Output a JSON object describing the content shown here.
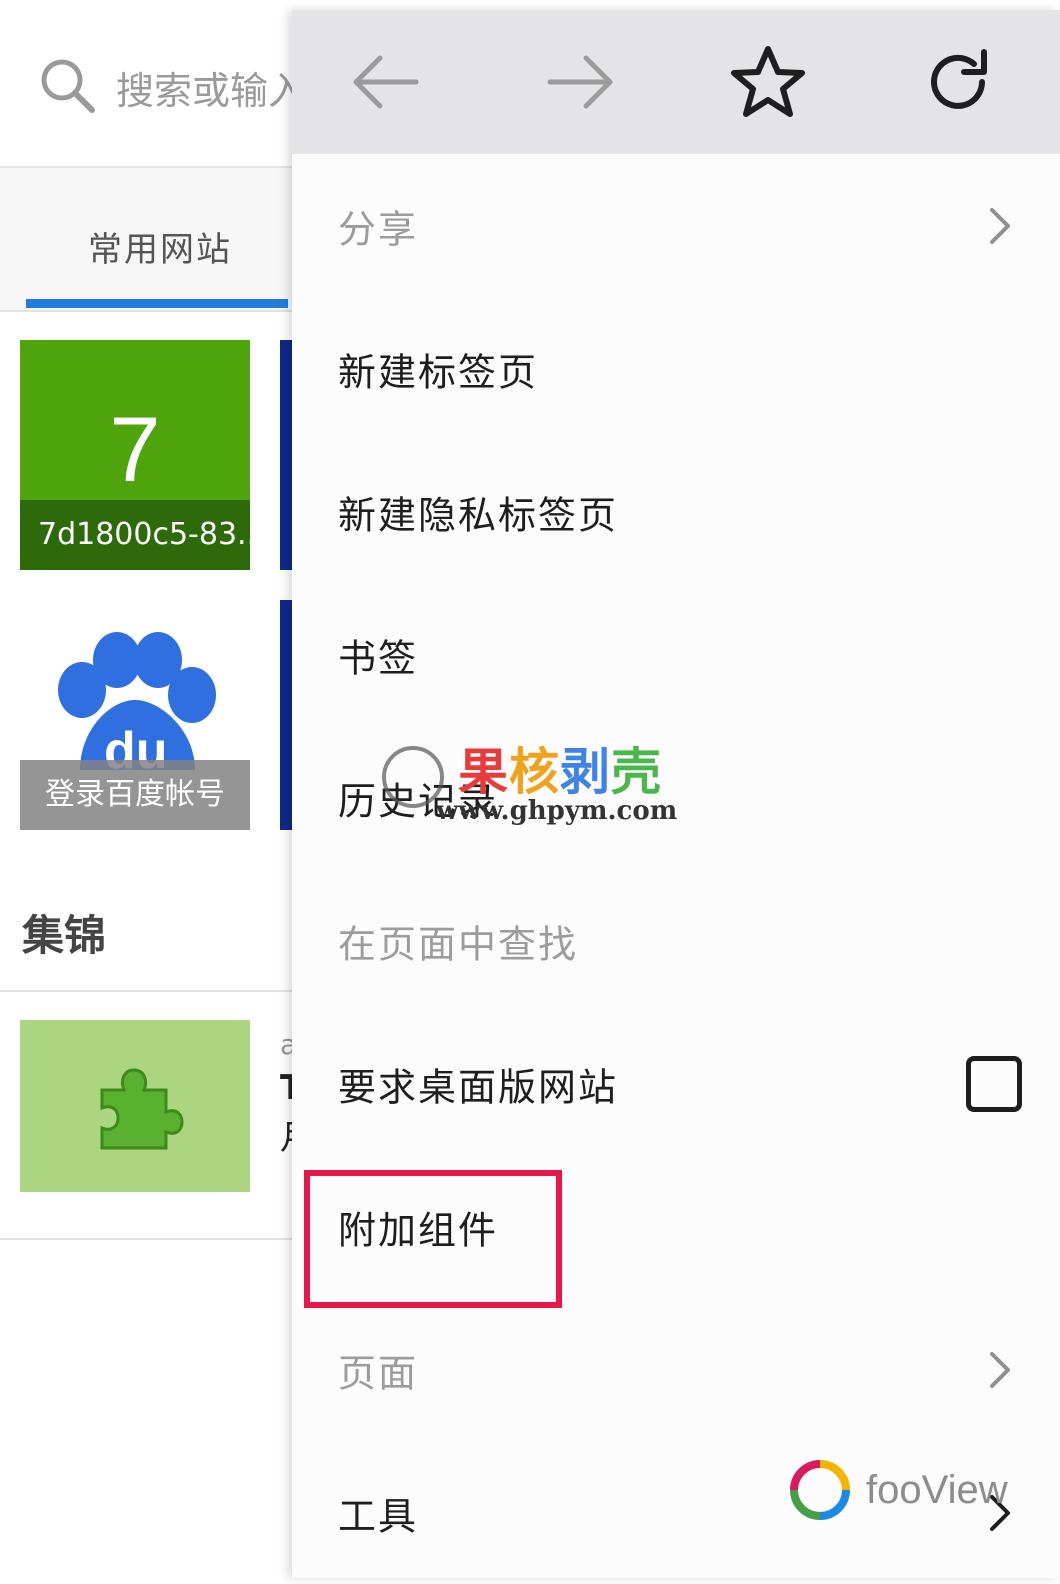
{
  "background_page": {
    "search_placeholder": "搜索或输入",
    "tab_label": "常用网站",
    "top_sites": [
      {
        "title": "7",
        "caption": "7d1800c5-83..."
      },
      {
        "caption": "登录百度帐号"
      }
    ],
    "section_title": "集锦",
    "peek_texts": [
      "a",
      "T",
      "月"
    ]
  },
  "toolbar": {
    "back": "back-arrow-icon",
    "forward": "forward-arrow-icon",
    "bookmark": "star-icon",
    "reload": "reload-icon"
  },
  "menu": {
    "items": [
      {
        "label": "分享",
        "enabled": false,
        "submenu": true
      },
      {
        "label": "新建标签页",
        "enabled": true
      },
      {
        "label": "新建隐私标签页",
        "enabled": true
      },
      {
        "label": "书签",
        "enabled": true
      },
      {
        "label": "历史记录",
        "enabled": true
      },
      {
        "label": "在页面中查找",
        "enabled": false
      },
      {
        "label": "要求桌面版网站",
        "enabled": true,
        "checkbox": true,
        "checked": false
      },
      {
        "label": "附加组件",
        "enabled": true,
        "highlighted": true
      },
      {
        "label": "页面",
        "enabled": false,
        "submenu": true
      },
      {
        "label": "工具",
        "enabled": true,
        "submenu": true
      }
    ]
  },
  "watermarks": {
    "guohe_brand": "果核剥壳",
    "guohe_url": "www.ghpym.com",
    "fooview": "fooView"
  },
  "colors": {
    "accent_blue": "#1f7ee0",
    "highlight_red": "#e8174a",
    "tile_green": "#4ea40d",
    "toolbar_gray": "#e4e4e6"
  }
}
